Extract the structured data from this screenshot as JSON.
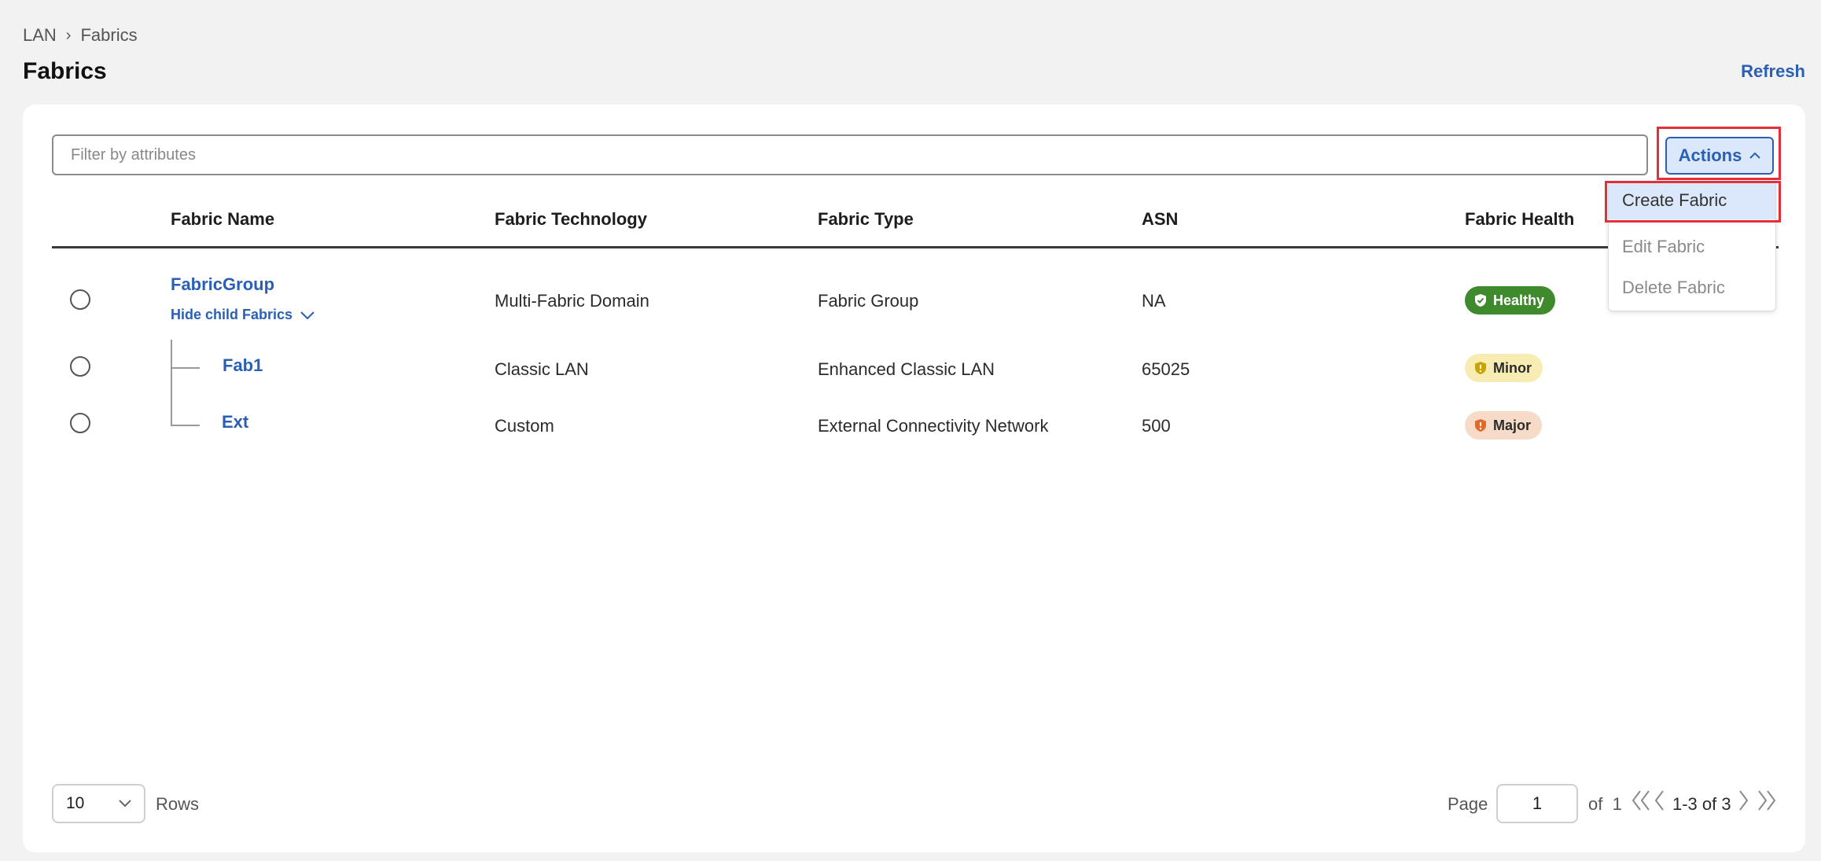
{
  "breadcrumb": {
    "root": "LAN",
    "current": "Fabrics"
  },
  "page": {
    "title": "Fabrics",
    "refresh_label": "Refresh"
  },
  "filter": {
    "placeholder": "Filter by attributes"
  },
  "actions": {
    "label": "Actions",
    "menu": [
      "Create Fabric",
      "Edit Fabric",
      "Delete Fabric"
    ],
    "active_item": "Create Fabric"
  },
  "table": {
    "headers": [
      "Fabric Name",
      "Fabric Technology",
      "Fabric Type",
      "ASN",
      "Fabric Health"
    ],
    "rows": [
      {
        "name": "FabricGroup",
        "toggle": "Hide child Fabrics",
        "technology": "Multi-Fabric Domain",
        "type": "Fabric Group",
        "asn": "NA",
        "health": "Healthy"
      },
      {
        "name": "Fab1",
        "technology": "Classic LAN",
        "type": "Enhanced Classic LAN",
        "asn": "65025",
        "health": "Minor"
      },
      {
        "name": "Ext",
        "technology": "Custom",
        "type": "External Connectivity Network",
        "asn": "500",
        "health": "Major"
      }
    ]
  },
  "pagination": {
    "rows_per_page": "10",
    "rows_label": "Rows",
    "page_label": "Page",
    "page": "1",
    "of_label": "of",
    "total_pages": "1",
    "range": "1-3 of 3"
  },
  "colors": {
    "accent": "#2a5fb5",
    "healthy": "#3e8a2c",
    "minor": "#f7ecb1",
    "major": "#f6dcc8",
    "highlight": "#e2303a"
  }
}
